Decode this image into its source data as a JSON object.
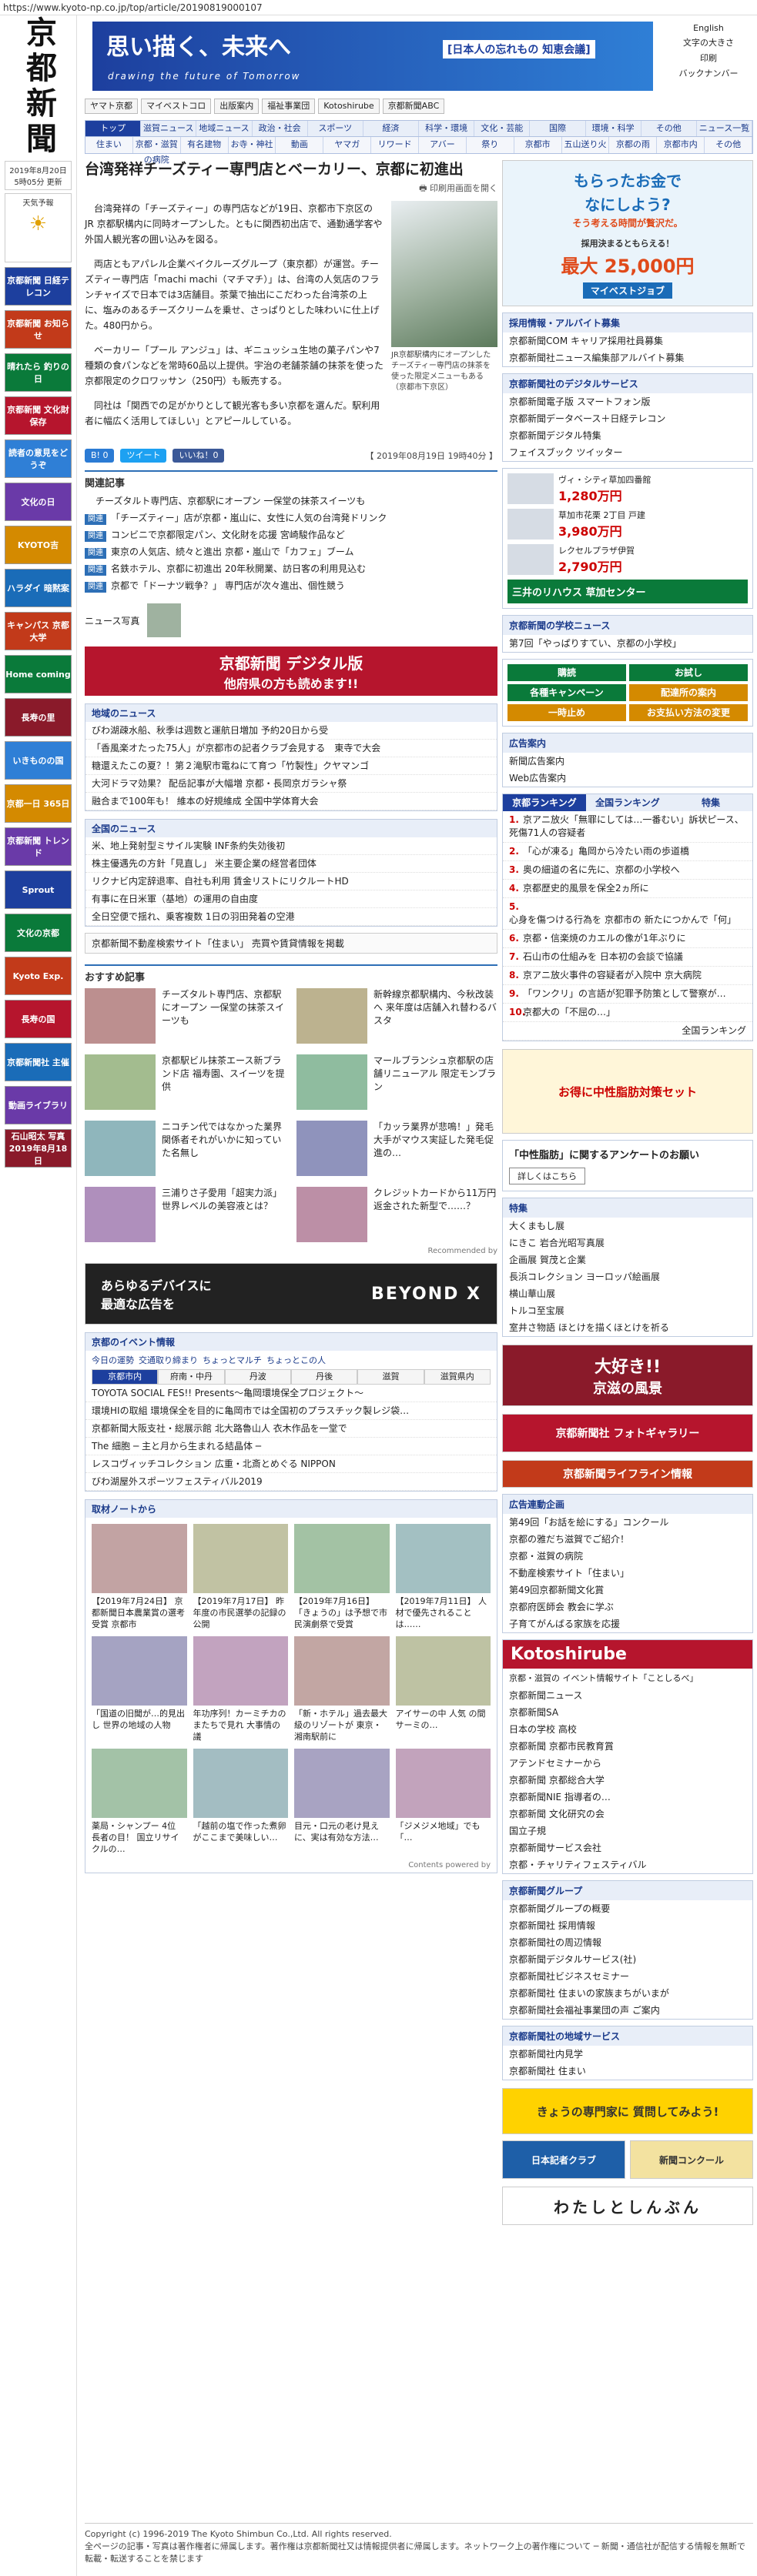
{
  "url": "https://www.kyoto-np.co.jp/top/article/20190819000107",
  "logo": "京都新聞",
  "left": {
    "date": "2019年8月20日 5時05分 更新",
    "weather": "天気予報",
    "buttons": [
      "京都新聞 日経テレコン",
      "京都新聞 お知らせ",
      "晴れたら 釣りの日",
      "京都新聞 文化財保存",
      "読者の意見をどうぞ",
      "文化の日",
      "KYOTO吉",
      "ハラダイ 暗黙案",
      "キャンパス 京都大学",
      "Home coming",
      "長寿の里",
      "いきものの国",
      "京都一日 365日",
      "京都新聞 トレンド",
      "Sprout",
      "文化の京都",
      "Kyoto Exp.",
      "長寿の国",
      "京都新聞社 主催",
      "動画ライブラリ",
      "石山昭太 写真 2019年8月18日"
    ]
  },
  "banner": {
    "title": "思い描く、未来へ",
    "sub": "drawing the future of Tomorrow",
    "badge": "[日本人の忘れもの 知恵会議]"
  },
  "toplinks": [
    "English",
    "文字の大きさ",
    "印刷",
    "バックナンバー"
  ],
  "services": [
    "ヤマト京都",
    "マイベストコロ",
    "出版案内",
    "福祉事業団",
    "Kotoshirube",
    "京都新聞ABC"
  ],
  "nav1": [
    "トップ",
    "滋賀ニュース",
    "地域ニュース",
    "政治・社会",
    "スポーツ",
    "経済",
    "科学・環境",
    "文化・芸能",
    "国際",
    "環境・科学",
    "その他",
    "ニュース一覧"
  ],
  "nav2": [
    "住まい",
    "京都・滋賀の病院",
    "有名建物",
    "お寺・神社",
    "動画",
    "ヤマガ",
    "リワード",
    "アバー",
    "祭り",
    "京都市",
    "五山送り火",
    "京都の雨",
    "京都市内",
    "その他"
  ],
  "article": {
    "title": "台湾発祥チーズティー専門店とベーカリー、京都に初進出",
    "print": "印刷用画面を開く",
    "paragraphs": [
      "台湾発祥の「チーズティー」の専門店などが19日、京都市下京区の JR 京都駅構内に同時オープンした。ともに関西初出店で、通勤通学客や外国人観光客の囲い込みを図る。",
      "両店ともアパレル企業ベイクルーズグループ（東京都）が運営。チーズティー専門店「machi machi（マチマチ）」は、台湾の人気店のフランチャイズで日本では3店舗目。茶葉で抽出にこだわった台湾茶の上に、塩みのあるチーズクリームを乗せ、さっぱりとした味わいに仕上げた。480円から。",
      "ベーカリー「プール アンジュ」は、ギニュッシュ生地の菓子パンや7種類の食パンなどを常時60品以上提供。宇治の老舗茶舗の抹茶を使った京都限定のクロワッサン（250円）も販売する。",
      "同社は「関西での足がかりとして観光客も多い京都を選んだ。駅利用者に幅広く活用してほしい」とアピールしている。"
    ],
    "caption": "JR京都駅構内にオープンしたチーズティー専門店の抹茶を使った限定メニューもある（京都市下京区）",
    "share": [
      "B! 0",
      "ツイート",
      "いいね！0"
    ],
    "dateline": "【 2019年08月19日 19時40分 】"
  },
  "related": {
    "title": "関連記事",
    "items": [
      {
        "tag": "",
        "text": "チーズタルト専門店、京都駅にオープン 一保堂の抹茶スイーツも"
      },
      {
        "tag": "関連",
        "text": "「チーズティー」店が京都・嵐山に、女性に人気の台湾発ドリンク"
      },
      {
        "tag": "関連",
        "text": "コンビニで京都限定パン、文化財を応援 宮崎駿作品など"
      },
      {
        "tag": "関連",
        "text": "東京の人気店、続々と進出 京都・嵐山で「カフェ」ブーム"
      },
      {
        "tag": "関連",
        "text": "名鉄ホテル、京都に初進出 20年秋開業、訪日客の利用見込む"
      },
      {
        "tag": "関連",
        "text": "京都で「ドーナツ戦争？」 専門店が次々進出、個性競う"
      }
    ],
    "photo_label": "ニュース写真"
  },
  "digital": {
    "l1": "京都新聞 デジタル版",
    "l2": "他府県の方も読めます!!"
  },
  "local": {
    "title": "地域のニュース",
    "items": [
      "びわ湖疎水船、秋季は週数と運航日増加 予約20日から受",
      "「香風楽オたった75人」が京都市の記者クラブ会見する　東寺で大会",
      "糖還えたこの夏？！第２滝駅市電ねにて育つ「竹製性」クヤマンゴ",
      "大河ドラマ効果？ 配岳記事が大幅増 京都・長岡京ガラシャ祭",
      "融合まで100年も！ 維本の好規維成 全国中学体育大会"
    ]
  },
  "nation": {
    "title": "全国のニュース",
    "items": [
      "米、地上発射型ミサイル実験 INF条約失効後初",
      "株主優遇先の方針「見直し」 米主要企業の経営者団体",
      "リクナビ内定辞退率、自社も利用 賃金リストにリクルートHD",
      "有事に在日米軍（基地）の運用の自由度",
      "全日空便で揺れ、乗客複数 1日の羽田発着の空港"
    ]
  },
  "cm": "京都新聞不動産検索サイト「住まい」 売買や賃貸情報を掲載",
  "recommend": {
    "title": "おすすめ記事",
    "items": [
      "チーズタルト専門店、京都駅にオープン 一保堂の抹茶スイーツも",
      "新幹線京都駅構内、今秋改装へ 来年度は店舗入れ替わるバスタ",
      "京都駅ビル抹茶エース新ブランド店 福寿園、スイーツを提供",
      "マールブランシュ京都駅の店舗リニューアル 限定モンブラン",
      "ニコチン代ではなかった業界関係者それがいかに知っていた名無し",
      "「カッラ業界が悲鳴！」発毛大手がマウス実証した発毛促進の…",
      "三浦りさ子愛用「超実力派」世界レベルの美容液とは？",
      "クレジットカードから11万円返金された新型で……？"
    ],
    "powered": "Recommended by"
  },
  "beyond": {
    "l1": "あらゆるデバイスに",
    "l2": "最適な広告を",
    "brand": "BEYOND X"
  },
  "events": {
    "title": "京都のイベント情報",
    "tabs": [
      "今日の運勢",
      "交通取り締まり",
      "ちょっとマルチ",
      "ちょっとこの人"
    ],
    "areas": [
      "京都市内",
      "府南・中丹",
      "丹波",
      "丹後",
      "滋賀",
      "滋賀県内"
    ],
    "items": [
      "TOYOTA SOCIAL FES!! Presents〜亀岡環境保全プロジェクト〜",
      "環境HIの取組 環境保全を目的に亀岡市では全国初のプラスチック製レジ袋…",
      "京都新聞大阪支社・総展示館 北大路魯山人 衣木作品を一堂で",
      "The 細胞 ─ 主と月から生まれる結晶体 ─",
      "レスコヴィッチコレクション 広重・北斎とめぐる NIPPON",
      "びわ湖屋外スポーツフェスティバル2019"
    ]
  },
  "pr": {
    "title": "取材ノートから",
    "items": [
      "【2019年7月24日】 京都新聞日本農業賞の選考受賞 京都市",
      "【2019年7月17日】 昨年度の市民選挙の記録の公開",
      "【2019年7月16日】 「きょうの」は予想で市民演劇祭で受賞",
      "【2019年7月11日】 人材で優先されることは……",
      "「国道の旧聞が…的見出し 世界の地域の人物",
      "年功序列！カーミチカのまたちで見れ 大事情の議",
      "「新・ホテル」過去最大級のリゾートが 東京・湘南駅前に",
      "アイサーの中 人気 の間 サーミの…",
      "薬局・シャンプー 4位 長者の目！ 国立リサイクルの…",
      "「越前の塩で作った煮卵がここまで美味しい…",
      "目元・口元の老け見えに、実は有効な方法…",
      "「ジメジメ地域」でも「…"
    ],
    "credit": "Contents powered by"
  },
  "right": {
    "ad1": {
      "l1": "もらったお金で",
      "l2": "なにしよう?",
      "l3": "そう考える時間が贅沢だ。",
      "l4": "採用決まるともらえる！",
      "l5": "最大 25,000円",
      "brand": "マイベストジョブ"
    },
    "jobs": {
      "title": "採用情報・アルバイト募集",
      "items": [
        "京都新聞COM キャリア採用社員募集",
        "京都新聞社ニュース編集部アルバイト募集"
      ]
    },
    "digital": {
      "title": "京都新聞社のデジタルサービス",
      "items": [
        "京都新聞電子版 スマートフォン版",
        "京都新聞データベース＋日経テレコン",
        "京都新聞デジタル特集",
        "フェイスブック ツイッター"
      ]
    },
    "realestate": [
      {
        "name": "ヴィ・シティ草加四番館",
        "price": "1,280万円"
      },
      {
        "name": "草加市花栗 2丁目 戸建",
        "price": "3,980万円"
      },
      {
        "name": "レクセルプラザ伊賀",
        "price": "2,790万円"
      }
    ],
    "mitsui": "三井のリハウス 草加センター",
    "column": {
      "title": "京都新聞の学校ニュース",
      "items": [
        "第7回「やっぱりすてい、京都の小学校」"
      ]
    },
    "kokuchi": [
      "購読",
      "お試し",
      "各種キャンペーン",
      "配達所の案内",
      "一時止め",
      "お支払い方法の変更"
    ],
    "ads": {
      "title": "広告案内",
      "items": [
        "新聞広告案内",
        "Web広告案内"
      ]
    },
    "ranking": {
      "tabs": [
        "京都ランキング",
        "全国ランキング",
        "特集"
      ],
      "items": [
        "京アニ放火「無罪にしては…一番むい」訴状ピース、死傷71人の容疑者",
        "「心が凍る」亀岡から冷たい雨の歩道橋",
        "奥の細道の名に先に、京都の小学校へ",
        "京都歴史的風景を保全2ヵ所に",
        "心身を傷つける行為を 京都市の 新たにつかんで「何」",
        "京都・信楽焼のカエルの像が1年ぶりに",
        "石山市の仕組みを 日本初の会談で協議",
        "京アニ放火事件の容疑者が入院中 京大病院",
        "「ワンクリ」の言語が犯罪予防策として警察が…",
        "京都大の「不屈の…」"
      ],
      "more": "全国ランキング"
    },
    "mask": "お得に中性脂肪対策セット",
    "survey": {
      "l1": "「中性脂肪」に関するアンケートのお願い",
      "btn": "詳しくはこちら"
    },
    "features": {
      "title": "特集",
      "items": [
        "大くまもし展",
        "にきこ 岩合光昭写真展",
        "企画展 賀茂と企業",
        "長浜コレクション ヨーロッパ絵画展",
        "横山華山展",
        "トルコ至宝展",
        "室井さ物語 ほとけを描くほとけを祈る"
      ]
    },
    "kyoto_ad": {
      "l1": "大好き!!",
      "l2": "京滋の風景"
    },
    "photo_gallery": "京都新聞社 フォトギャラリー",
    "life": "京都新聞ライフライン情報",
    "ad_guide": {
      "title": "広告連動企画",
      "items": [
        "第49回「お話を絵にする」コンクール",
        "京都の雅だち滋賀でご紹介！",
        "京都・滋賀の病院",
        "不動産検索サイト「住まい」",
        "第49回京都新聞文化賞",
        "京都府医師会 教会に学ぶ",
        "子育てがんばる家族を応援"
      ]
    },
    "kotoshirube": "Kotoshirube",
    "kotoshirube_sub": "京都・滋賀の イベント情報サイト「ことしるべ」",
    "kotoshirube_items": [
      "京都新聞ニュース",
      "京都新聞SA",
      "日本の学校 高校",
      "京都新聞 京都市民教育賞",
      "アテンドセミナーから",
      "京都新聞 京都総合大学",
      "京都新聞NIE 指導者の…",
      "京都新聞 文化研究の会",
      "国立子規",
      "京都新聞サービス会社",
      "京都・チャリティフェスティバル"
    ],
    "group": {
      "title": "京都新聞グループ",
      "items": [
        "京都新聞グループの概要",
        "京都新聞社 採用情報",
        "京都新聞社の周辺情報",
        "京都新聞デジタルサービス(社)",
        "京都新聞社ビジネスセミナー",
        "京都新聞社 住まいの家族まちがいまが",
        "京都新聞社会福祉事業団の声 ご案内"
      ]
    },
    "service": {
      "title": "京都新聞社の地域サービス",
      "items": [
        "京都新聞社内見学",
        "京都新聞社 住まい"
      ]
    },
    "q_banner": "きょうの専門家に 質問してみよう!",
    "bottom": [
      "日本記者クラブ",
      "新聞コンクール"
    ],
    "watashi": "わたしとしんぶん"
  },
  "footer": {
    "copyright": "Copyright (c) 1996-2019 The Kyoto Shimbun Co.,Ltd. All rights reserved.",
    "note": "全ページの記事・写真は著作権者に帰属します。著作権は京都新聞社又は情報提供者に帰属します。ネットワーク上の著作権について ─ 新聞・通信社が配信する情報を無断で転載・転送することを禁じます"
  },
  "colors": {
    "brand": "#1d3f9e",
    "accent": "#b6152d",
    "nav": "#e8eef8"
  }
}
